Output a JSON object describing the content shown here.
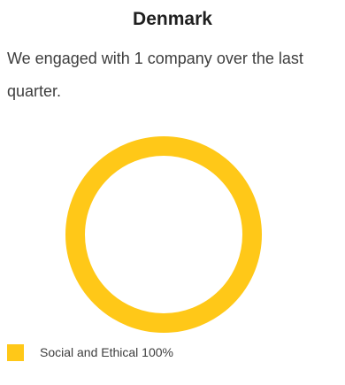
{
  "title": "Denmark",
  "description": "We engaged with 1 company over the last quarter.",
  "chart_data": {
    "type": "pie",
    "style": "donut",
    "title": "",
    "categories": [
      "Social and Ethical"
    ],
    "values": [
      100
    ],
    "unit": "%",
    "colors": [
      "#FFC818"
    ],
    "legend": {
      "placement": "bottom-left",
      "entries": [
        "Social and Ethical 100%"
      ]
    }
  }
}
